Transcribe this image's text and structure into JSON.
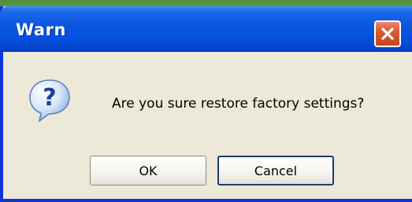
{
  "dialog": {
    "title": "Warn",
    "message": "Are you sure restore factory settings?",
    "icon": "question-icon",
    "buttons": {
      "ok_label": "OK",
      "cancel_label": "Cancel"
    }
  },
  "colors": {
    "titlebar": "#0a55dd",
    "window_bg": "#ece9d8",
    "close_button": "#d95a33"
  }
}
